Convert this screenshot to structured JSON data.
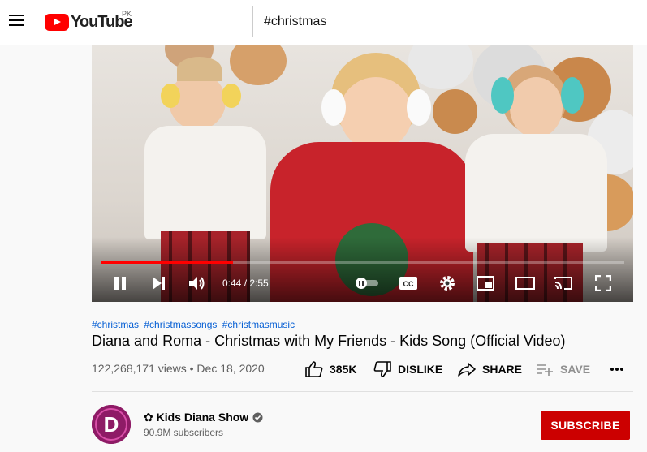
{
  "header": {
    "logo_text": "YouTube",
    "region": "PK",
    "search_value": "#christmas"
  },
  "player": {
    "time_display": "0:44 / 2:55",
    "progress_fraction": 0.252
  },
  "video": {
    "hashtags": [
      "#christmas",
      "#christmassongs",
      "#christmasmusic"
    ],
    "title": "Diana and Roma - Christmas with My Friends - Kids Song (Official Video)",
    "views_date": "122,268,171 views • Dec 18, 2020",
    "likes": "385K",
    "dislike_label": "DISLIKE",
    "share_label": "SHARE",
    "save_label": "SAVE"
  },
  "channel": {
    "avatar_letter": "D",
    "name": "✿ Kids Diana Show",
    "subscribers": "90.9M subscribers",
    "subscribe_label": "SUBSCRIBE"
  }
}
